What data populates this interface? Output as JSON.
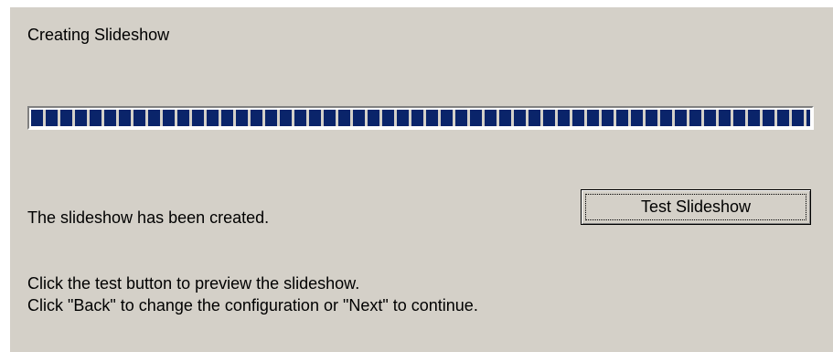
{
  "dialog": {
    "heading": "Creating Slideshow",
    "progress": {
      "percent": 100,
      "fill_color": "#0a246a"
    },
    "status_text": "The slideshow has been created.",
    "test_button_label": "Test Slideshow",
    "instructions": [
      "Click the test button to preview the slideshow.",
      "Click \"Back\" to change the configuration or \"Next\" to continue."
    ],
    "background_color": "#d4d0c8"
  }
}
